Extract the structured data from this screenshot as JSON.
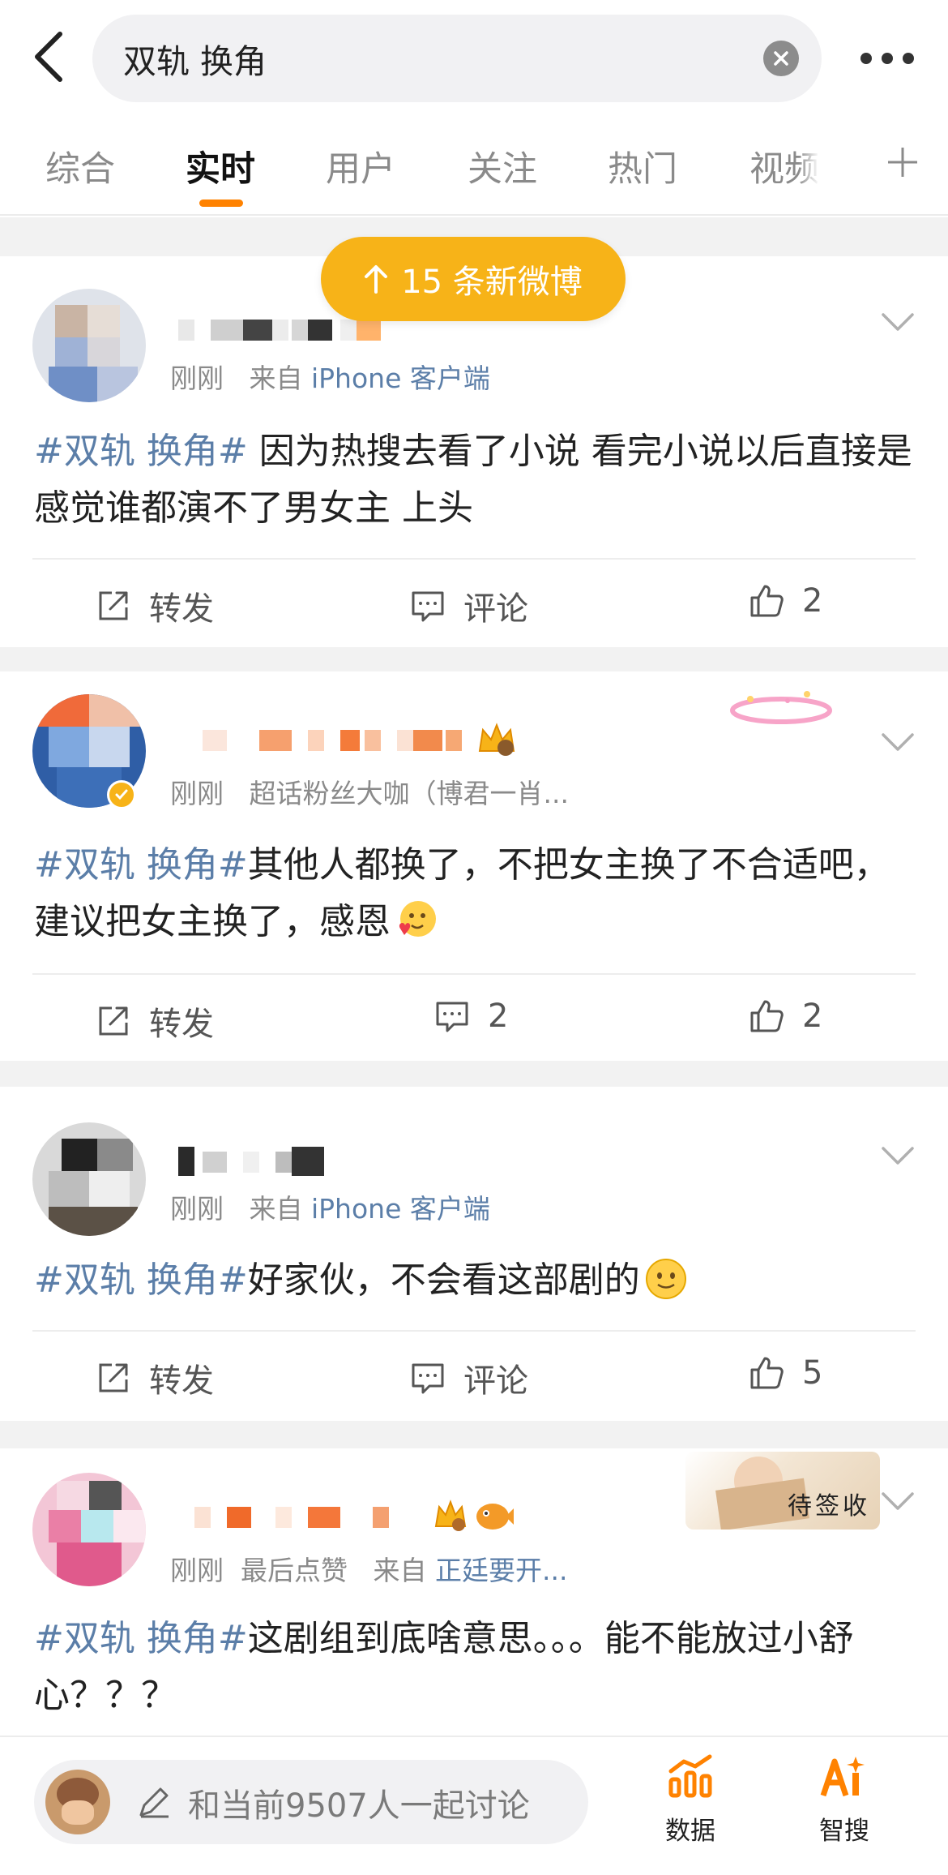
{
  "search": {
    "query": "双轨 换角"
  },
  "tabs": [
    "综合",
    "实时",
    "用户",
    "关注",
    "热门",
    "视频"
  ],
  "active_tab": "实时",
  "new_posts_label": "15 条新微博",
  "posts": [
    {
      "time": "刚刚",
      "source_prefix": "来自",
      "source": "iPhone 客户端",
      "hashtag": "#双轨 换角#",
      "text": " 因为热搜去看了小说 看完小说以后直接是感觉谁都演不了男女主 上头",
      "repost": "转发",
      "comment": "评论",
      "likes": "2"
    },
    {
      "time": "刚刚",
      "source_prefix": "",
      "source": "超话粉丝大咖（博君一肖...",
      "hashtag": "#双轨 换角#",
      "text": "其他人都换了，不把女主换了不合适吧，建议把女主换了，感恩",
      "repost": "转发",
      "comment": "2",
      "likes": "2"
    },
    {
      "time": "刚刚",
      "source_prefix": "来自",
      "source": "iPhone 客户端",
      "hashtag": "#双轨 换角#",
      "text": "好家伙，不会看这部剧的",
      "repost": "转发",
      "comment": "评论",
      "likes": "5"
    },
    {
      "time": "刚刚",
      "extra": "最后点赞",
      "source_prefix": "来自",
      "source": "正廷要开...",
      "hashtag": "#双轨 换角#",
      "text": "这剧组到底啥意思。。。能不能放过小舒心？？？",
      "badge_text": "待签收"
    }
  ],
  "bottom": {
    "placeholder": "和当前9507人一起讨论",
    "data_label": "数据",
    "search_label": "智搜"
  },
  "colors": {
    "accent": "#ff8200",
    "pill": "#f7b318",
    "link": "#5b7ea8"
  }
}
